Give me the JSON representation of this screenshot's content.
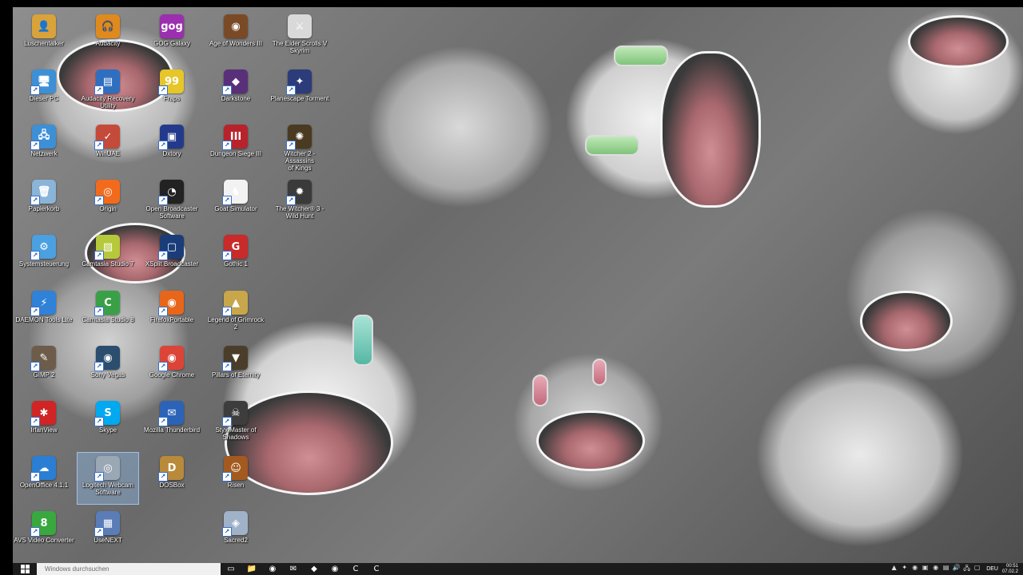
{
  "desktop": {
    "icons": [
      {
        "label": "Luschentalker",
        "glyph": "👤",
        "color": "#d9a23b"
      },
      {
        "label": "Audacity",
        "glyph": "🎧",
        "color": "#e08a1e"
      },
      {
        "label": "GOG Galaxy",
        "glyph": "gog",
        "color": "#9b2fb0"
      },
      {
        "label": "Age of Wonders III",
        "glyph": "◉",
        "color": "#7a4a26"
      },
      {
        "label": "The Elder Scrolls V\nSkyrim",
        "glyph": "⚔",
        "color": "#d9d9d9"
      },
      {
        "label": "Dieser PC",
        "glyph": "🖥",
        "color": "#3d8fd6"
      },
      {
        "label": "Audacity Recovery\nUtility",
        "glyph": "▤",
        "color": "#2f6fc0"
      },
      {
        "label": "Fraps",
        "glyph": "99",
        "color": "#e6c629"
      },
      {
        "label": "Darkstone",
        "glyph": "◆",
        "color": "#5a2f7a"
      },
      {
        "label": "Planescape Torment",
        "glyph": "✦",
        "color": "#2c3c7a"
      },
      {
        "label": "Netzwerk",
        "glyph": "🖧",
        "color": "#3d8fd6"
      },
      {
        "label": "WinUAE",
        "glyph": "✓",
        "color": "#c44a3a"
      },
      {
        "label": "Dxtory",
        "glyph": "▣",
        "color": "#233a8c"
      },
      {
        "label": "Dungeon Siege III",
        "glyph": "III",
        "color": "#b8232b"
      },
      {
        "label": "Witcher 2 - Assassins\nof Kings",
        "glyph": "✺",
        "color": "#4a3a22"
      },
      {
        "label": "Papierkorb",
        "glyph": "🗑",
        "color": "#8ab4d8"
      },
      {
        "label": "Origin",
        "glyph": "◎",
        "color": "#f26b1d"
      },
      {
        "label": "Open Broadcaster\nSoftware",
        "glyph": "◔",
        "color": "#222222"
      },
      {
        "label": "Goat Simulator",
        "glyph": "♞",
        "color": "#f2f2f2"
      },
      {
        "label": "The Witcher® 3 -\nWild Hunt",
        "glyph": "✹",
        "color": "#3a3a3a"
      },
      {
        "label": "Systemsteuerung",
        "glyph": "⚙",
        "color": "#4aa0e0"
      },
      {
        "label": "Camtasia Studio 7",
        "glyph": "▧",
        "color": "#b6c93a"
      },
      {
        "label": "XSplit Broadcaster",
        "glyph": "▢",
        "color": "#1a3d7a"
      },
      {
        "label": "Gothic 1",
        "glyph": "G",
        "color": "#c92a2a"
      },
      {
        "label": "DAEMON Tools Lite",
        "glyph": "⚡",
        "color": "#2f82d8"
      },
      {
        "label": "Camtasia Studio 8",
        "glyph": "C",
        "color": "#3aa047"
      },
      {
        "label": "FirefoxPortable",
        "glyph": "◉",
        "color": "#e8661a"
      },
      {
        "label": "Legend of Grimrock 2",
        "glyph": "▲",
        "color": "#c8a64a"
      },
      {
        "label": "GIMP 2",
        "glyph": "✎",
        "color": "#6d5c4a"
      },
      {
        "label": "Sony Vegas",
        "glyph": "◉",
        "color": "#2b4d6e"
      },
      {
        "label": "Google Chrome",
        "glyph": "◉",
        "color": "#db4437"
      },
      {
        "label": "Pillars of Eternity",
        "glyph": "▼",
        "color": "#4a3e2a"
      },
      {
        "label": "IrfanView",
        "glyph": "✱",
        "color": "#d12424"
      },
      {
        "label": "Skype",
        "glyph": "S",
        "color": "#00a9f0"
      },
      {
        "label": "Mozilla Thunderbird",
        "glyph": "✉",
        "color": "#2b63b8"
      },
      {
        "label": "Styx Master of\nShadows",
        "glyph": "☠",
        "color": "#3d3d3d"
      },
      {
        "label": "OpenOffice 4.1.1",
        "glyph": "☁",
        "color": "#2a7fd4"
      },
      {
        "label": "Logitech Webcam\nSoftware",
        "glyph": "◎",
        "color": "#9aa7b4"
      },
      {
        "label": "DOSBox",
        "glyph": "D",
        "color": "#b88a3a"
      },
      {
        "label": "Risen",
        "glyph": "☺",
        "color": "#a35a1e"
      },
      {
        "label": "AVS Video Converter",
        "glyph": "8",
        "color": "#39a83f"
      },
      {
        "label": "UseNEXT",
        "glyph": "▦",
        "color": "#5a7db8"
      },
      {
        "label": "Sacred2",
        "glyph": "◈",
        "color": "#9fb2c8"
      }
    ]
  },
  "taskbar": {
    "search_placeholder": "Windows durchsuchen",
    "pinned": [
      {
        "name": "task-view-icon",
        "glyph": "▭"
      },
      {
        "name": "file-explorer-icon",
        "glyph": "📁"
      },
      {
        "name": "firefox-icon",
        "glyph": "◉"
      },
      {
        "name": "thunderbird-icon",
        "glyph": "✉"
      },
      {
        "name": "app-icon",
        "glyph": "◆"
      },
      {
        "name": "steam-icon",
        "glyph": "◉"
      },
      {
        "name": "camtasia-icon",
        "glyph": "C"
      },
      {
        "name": "camtasia-recorder-icon",
        "glyph": "C"
      }
    ],
    "tray": {
      "icons": [
        "▲",
        "✦",
        "◉",
        "▣",
        "◉",
        "▤",
        "🔊",
        "🖧",
        "▢"
      ],
      "language": "DEU",
      "time": "00:51",
      "date": "07.02.2"
    }
  }
}
